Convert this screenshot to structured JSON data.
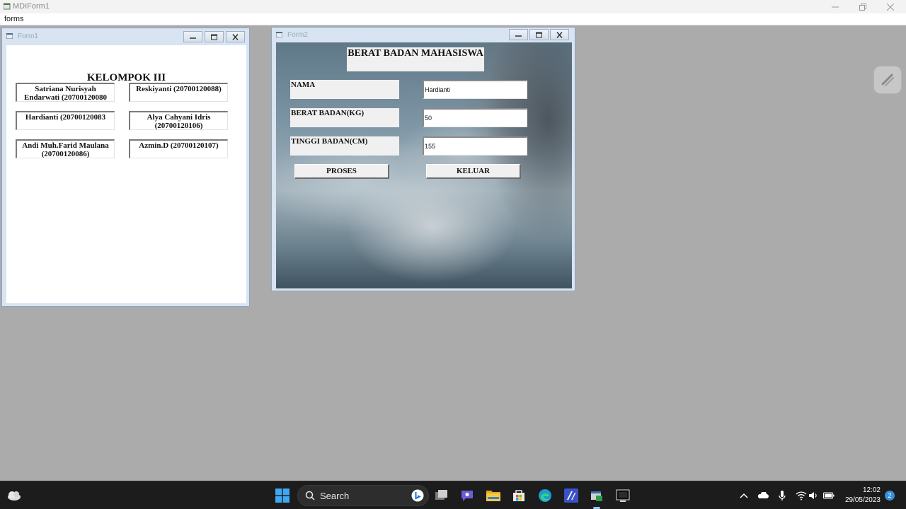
{
  "mdi": {
    "title": "MDIForm1",
    "menu": [
      "forms"
    ]
  },
  "form1": {
    "title": "Form1",
    "heading": "KELOMPOK III",
    "members": [
      "Satriana Nurisyah Endarwati (20700120080",
      "Reskiyanti (20700120088)",
      "Hardianti (20700120083",
      "Alya Cahyani Idris (20700120106)",
      "Andi Muh.Farid Maulana (20700120086)",
      "Azmin.D (20700120107)"
    ]
  },
  "form2": {
    "title": "Form2",
    "heading": "BERAT BADAN MAHASISWA",
    "fields": [
      {
        "label": "NAMA",
        "value": "Hardianti"
      },
      {
        "label": "BERAT BADAN(KG)",
        "value": "50"
      },
      {
        "label": "TINGGI BADAN(CM)",
        "value": "155"
      }
    ],
    "buttons": {
      "process": "PROSES",
      "exit": "KELUAR"
    }
  },
  "taskbar": {
    "search_placeholder": "Search",
    "time": "12:02",
    "date": "29/05/2023",
    "notifications": "2",
    "icons": [
      "weather-icon",
      "windows-start-icon",
      "search-icon",
      "bing-icon",
      "task-view-icon",
      "teams-chat-icon",
      "file-explorer-icon",
      "microsoft-store-icon",
      "edge-icon",
      "visual-studio-icon",
      "vb6-ide-icon",
      "app-icon"
    ]
  },
  "colors": {
    "desktop": "#ababab",
    "taskbar": "#1c1c1c",
    "accent": "#3a8fd9"
  }
}
